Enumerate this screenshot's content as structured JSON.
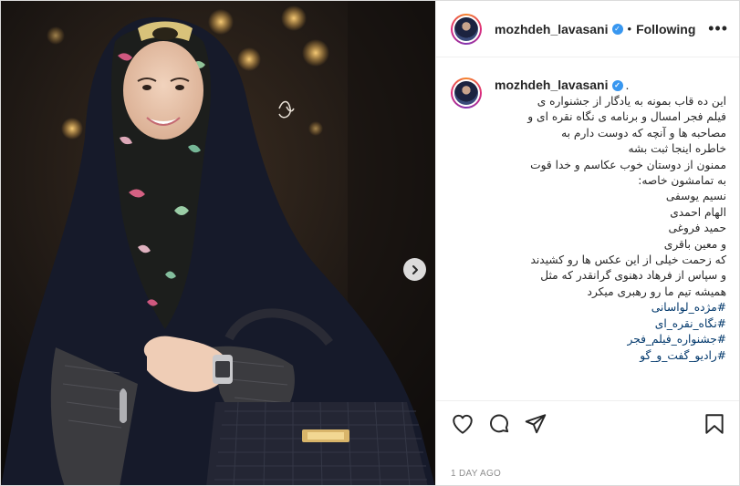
{
  "post": {
    "username": "mozhdeh_lavasani",
    "verified_badge": "✓",
    "follow_status": "Following",
    "more_icon": "more-dots-icon",
    "caption_head_suffix": ".",
    "caption_lines": [
      "این ده قاب بمونه به یادگار از جشنواره ی",
      "فیلم فجر امسال و برنامه ی نگاه نقره ای و",
      "مصاحبه ها و آنچه که دوست دارم به",
      "خاطره اینجا ثبت بشه",
      "ممنون از دوستان خوب عکاسم و خدا قوت",
      "به تمامشون خاصه:",
      "نسیم یوسفی",
      "الهام احمدی",
      "حمید فروغی",
      "و معین باقری",
      "که زحمت خیلی از این عکس ها رو کشیدند",
      "و سپاس از فرهاد دهنوی گرانقدر که مثل",
      "همیشه تیم ما رو رهبری میکرد"
    ],
    "hashtags": [
      "#مژده_لواسانی",
      "#نگاه_نقره_ای",
      "#جشنواره_فیلم_فجر",
      "#رادیو_گفت_و_گو"
    ],
    "date_label": "1 DAY AGO",
    "icons": {
      "like": "heart-icon",
      "comment": "comment-icon",
      "share": "share-icon",
      "save": "bookmark-icon",
      "next": "chevron-right-icon"
    },
    "colors": {
      "link": "#00376b",
      "verified": "#3897f0",
      "border": "#dbdbdb"
    }
  }
}
